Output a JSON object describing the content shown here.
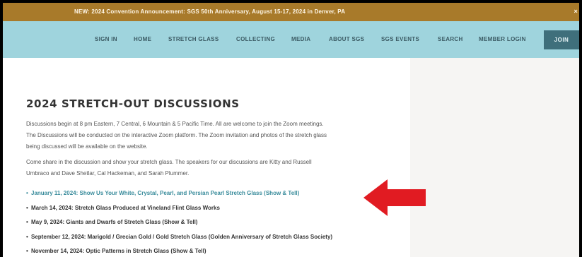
{
  "announcement": {
    "text": "NEW:  2024 Convention Announcement:  SGS 50th Anniversary, August 15-17, 2024 in Denver, PA",
    "close_glyph": "×"
  },
  "nav": {
    "items": [
      {
        "label": "SIGN IN"
      },
      {
        "label": "HOME"
      },
      {
        "label": "STRETCH GLASS"
      },
      {
        "label": "COLLECTING"
      },
      {
        "label": "MEDIA"
      },
      {
        "label": "ABOUT SGS"
      },
      {
        "label": "SGS EVENTS"
      },
      {
        "label": "SEARCH"
      },
      {
        "label": "MEMBER LOGIN"
      }
    ],
    "join_label": "JOIN"
  },
  "main": {
    "title": "2024 STRETCH-OUT DISCUSSIONS",
    "paragraph1": [
      "Discussions begin at 8 pm Eastern, 7 Central, 6 Mountain & 5 Pacific Time.  All are welcome to join the Zoom meetings.",
      "The Discussions will be conducted on the interactive Zoom platform.  The Zoom invitation and photos of the stretch glass",
      "being discussed will be available on the website."
    ],
    "paragraph2": [
      "Come share in the discussion and show your stretch glass.  The speakers for our discussions are Kitty and Russell",
      "Umbraco and Dave Shetlar, Cal Hackeman, and Sarah Plummer."
    ],
    "events": [
      {
        "text": "January 11, 2024:  Show Us Your White, Crystal, Pearl, and Persian Pearl Stretch Glass (Show & Tell)",
        "is_link": true
      },
      {
        "text": "March 14, 2024:  Stretch Glass Produced at Vineland Flint Glass Works",
        "is_link": false
      },
      {
        "text": "May 9, 2024:  Giants and Dwarfs of Stretch Glass (Show & Tell)",
        "is_link": false
      },
      {
        "text": "September 12, 2024:  Marigold / Grecian Gold / Gold Stretch Glass (Golden Anniversary of Stretch Glass Society)",
        "is_link": false
      },
      {
        "text": "November 14, 2024:  Optic Patterns in Stretch Glass (Show & Tell)",
        "is_link": false
      }
    ],
    "bullet_glyph": "•"
  },
  "colors": {
    "announcement_bg": "#a87a2a",
    "nav_bg": "#9fd4dd",
    "join_bg": "#3f6f7b",
    "link": "#3a8c9c",
    "arrow": "#e11b22"
  }
}
